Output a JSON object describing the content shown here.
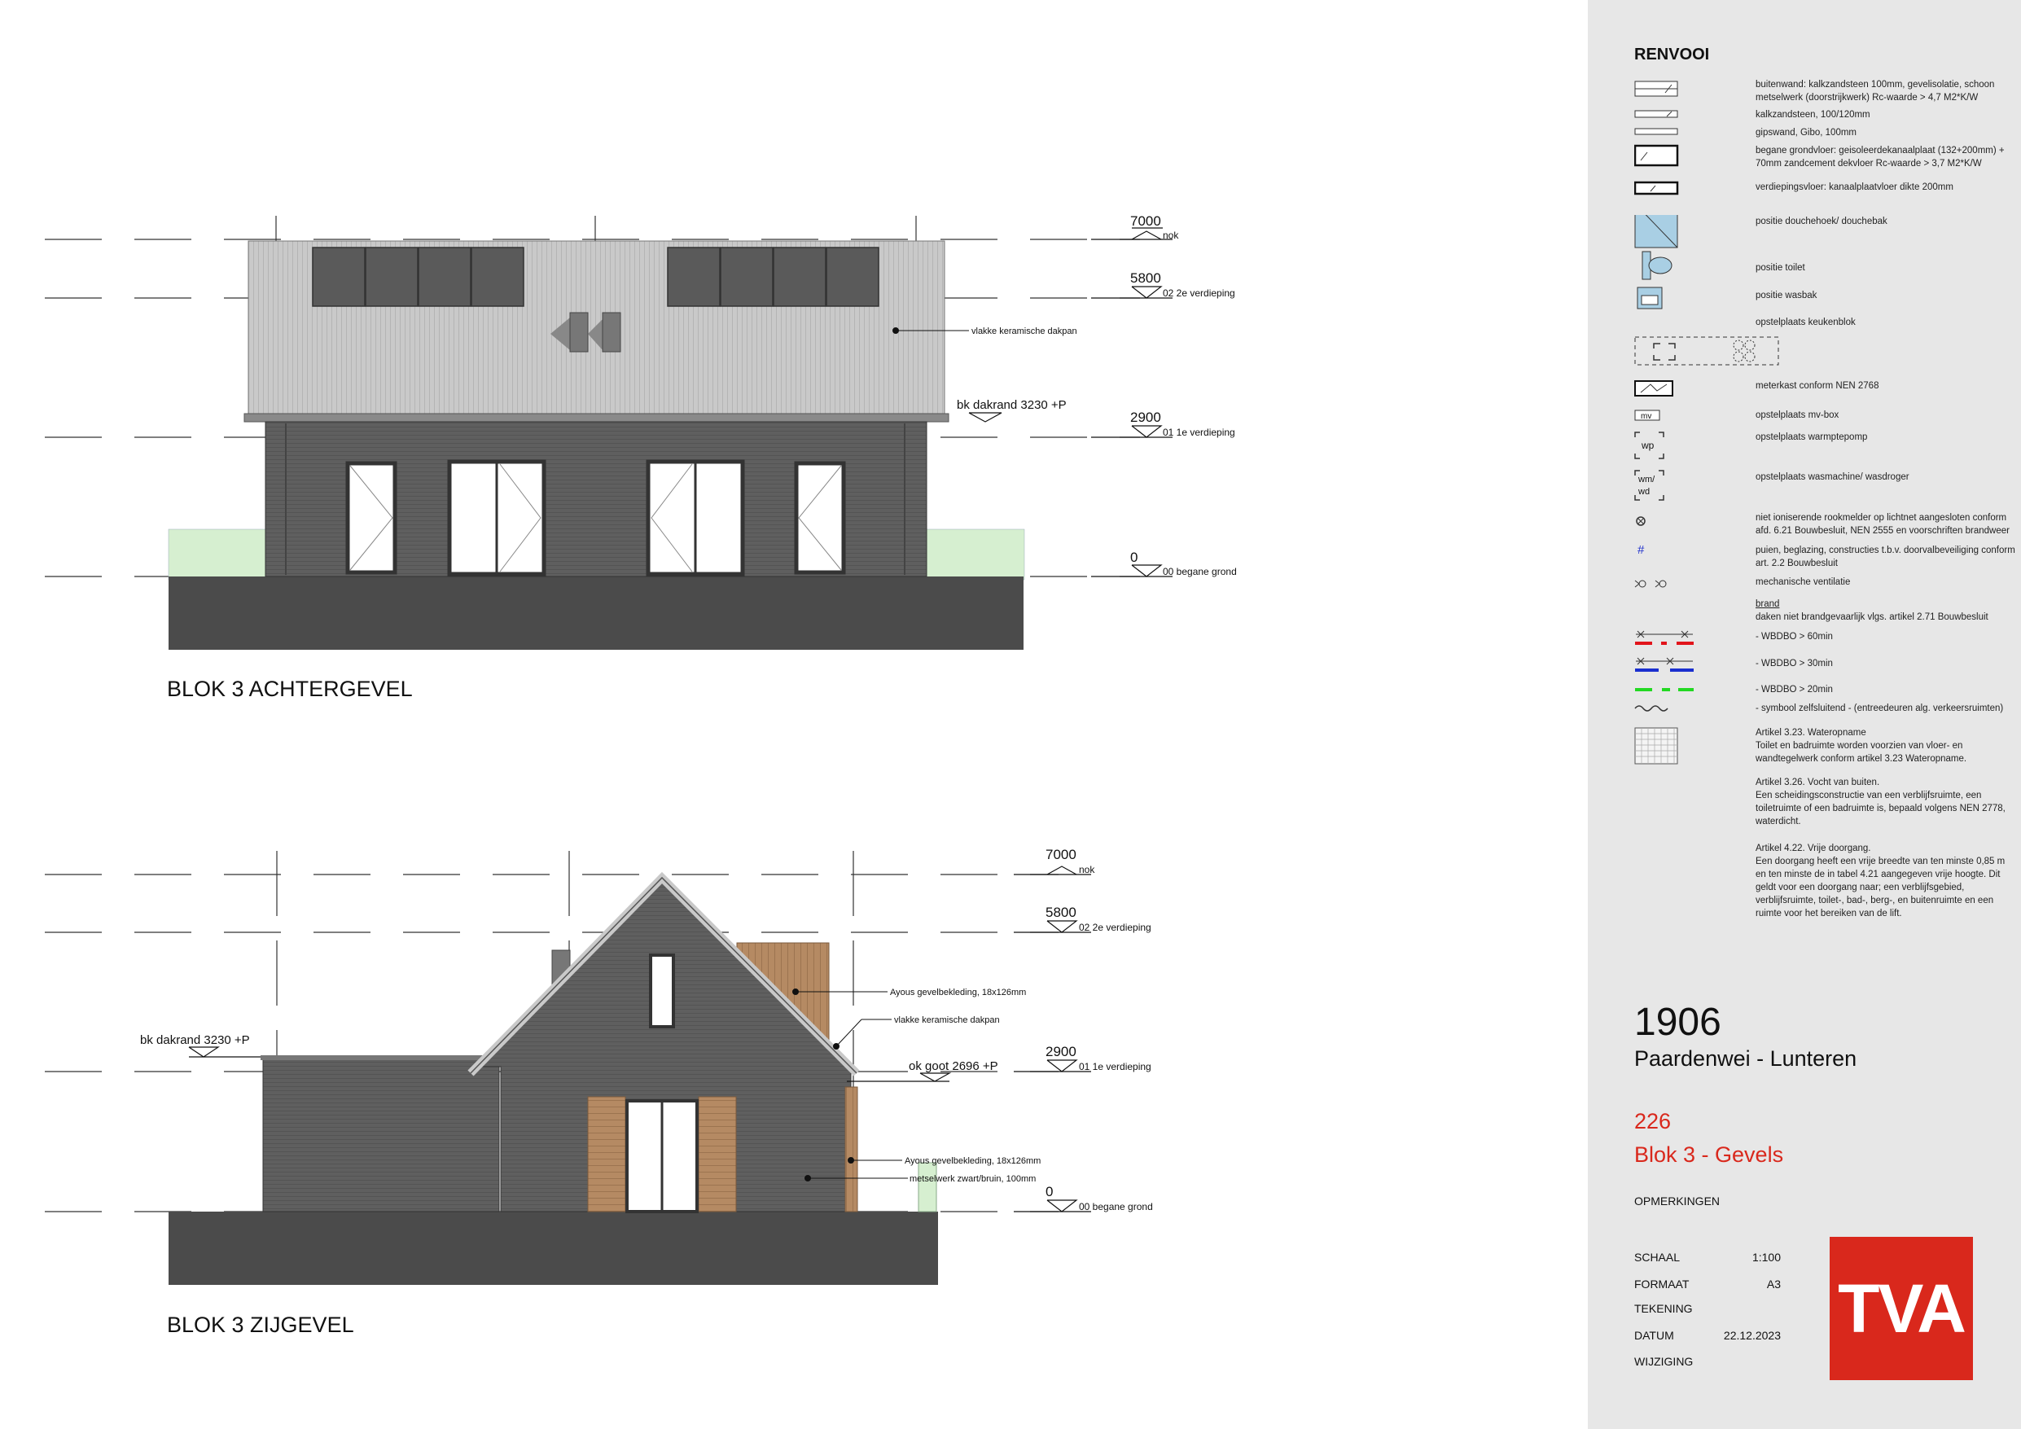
{
  "elevations": [
    {
      "title": "BLOK 3 ACHTERGEVEL",
      "levels": [
        {
          "value": "7000",
          "label": "nok"
        },
        {
          "value": "5800",
          "label": "02 2e verdieping"
        },
        {
          "value": "2900",
          "label": "01 1e verdieping"
        },
        {
          "value": "0",
          "label": "00 begane grond"
        }
      ],
      "annotations": {
        "roof": "vlakke keramische dakpan",
        "eave": "bk dakrand 3230 +P"
      }
    },
    {
      "title": "BLOK 3 ZIJGEVEL",
      "levels": [
        {
          "value": "7000",
          "label": "nok"
        },
        {
          "value": "5800",
          "label": "02 2e verdieping"
        },
        {
          "value": "2900",
          "label": "01 1e verdieping"
        },
        {
          "value": "0",
          "label": "00 begane grond"
        }
      ],
      "annotations": {
        "cladding_upper": "Ayous gevelbekleding, 18x126mm",
        "roof": "vlakke keramische dakpan",
        "eave_left": "bk dakrand 3230 +P",
        "gutter": "ok goot 2696 +P",
        "cladding_lower": "Ayous gevelbekleding, 18x126mm",
        "brick": "metselwerk zwart/bruin, 100mm"
      }
    }
  ],
  "legend": {
    "title": "RENVOOI",
    "items": [
      {
        "text": "buitenwand: kalkzandsteen 100mm, gevelisolatie, schoon metselwerk (doorstrijkwerk) Rc-waarde > 4,7 M2*K/W"
      },
      {
        "text": "kalkzandsteen, 100/120mm"
      },
      {
        "text": "gipswand, Gibo, 100mm"
      },
      {
        "text": "begane grondvloer: geisoleerdekanaalplaat (132+200mm) + 70mm zandcement dekvloer Rc-waarde > 3,7 M2*K/W"
      },
      {
        "text": "verdiepingsvloer: kanaalplaatvloer dikte 200mm"
      },
      {
        "text": "positie douchehoek/ douchebak"
      },
      {
        "text": "positie toilet"
      },
      {
        "text": "positie wasbak"
      },
      {
        "text": "opstelplaats keukenblok"
      },
      {
        "text": "meterkast conform NEN 2768"
      },
      {
        "text": "opstelplaats mv-box",
        "symbol_text": "mv"
      },
      {
        "text": "opstelplaats warmptepomp",
        "symbol_text": "wp"
      },
      {
        "text": "opstelplaats wasmachine/ wasdroger",
        "symbol_text": "wm/ wd"
      },
      {
        "text": "niet ioniserende rookmelder op lichtnet aangesloten conform afd. 6.21 Bouwbesluit, NEN 2555 en voorschriften brandweer"
      },
      {
        "text": "puien, beglazing, constructies t.b.v. doorvalbeveiliging conform art. 2.2 Bouwbesluit",
        "symbol_text": "#"
      },
      {
        "text": "mechanische ventilatie"
      },
      {
        "text": "brand"
      },
      {
        "text": "daken niet brandgevaarlijk vlgs. artikel 2.71 Bouwbesluit"
      },
      {
        "text": "- WBDBO > 60min"
      },
      {
        "text": "- WBDBO > 30min"
      },
      {
        "text": "- WBDBO > 20min"
      },
      {
        "text": "- symbool zelfsluitend - (entreedeuren alg. verkeersruimten)"
      },
      {
        "text": "Artikel 3.23. Wateropname\nToilet en badruimte worden voorzien van vloer- en wandtegelwerk conform artikel 3.23 Wateropname."
      },
      {
        "text": "Artikel 3.26. Vocht van buiten.\nEen scheidingsconstructie van een verblijfsruimte, een toiletruimte of een badruimte is, bepaald volgens NEN 2778, waterdicht."
      },
      {
        "text": "Artikel 4.22. Vrije doorgang.\nEen doorgang heeft een vrije breedte van ten minste 0,85 m en ten minste de in tabel 4.21 aangegeven vrije hoogte. Dit geldt voor een doorgang naar; een verblijfsgebied, verblijfsruimte, toilet-, bad-, berg-, en buitenruimte en een ruimte voor het bereiken van de lift."
      }
    ]
  },
  "title_block": {
    "project_number": "1906",
    "project_name": "Paardenwei - Lunteren",
    "sheet_number": "226",
    "sheet_title": "Blok 3 - Gevels",
    "remarks_label": "OPMERKINGEN",
    "fields": [
      {
        "key": "SCHAAL",
        "value": "1:100"
      },
      {
        "key": "FORMAAT",
        "value": "A3"
      },
      {
        "key": "TEKENING",
        "value": ""
      },
      {
        "key": "DATUM",
        "value": "22.12.2023"
      },
      {
        "key": "WIJZIGING",
        "value": ""
      }
    ],
    "logo_text": "TVA"
  },
  "colors": {
    "accent_red": "#d9281c",
    "wall_dark": "#5f5f5f",
    "roof_grey": "#c9c9c9",
    "ground_dark": "#4b4b4b",
    "grass_green": "#d6efd0",
    "wood": "#b58a63",
    "panel_grey": "#e7e7e7"
  }
}
